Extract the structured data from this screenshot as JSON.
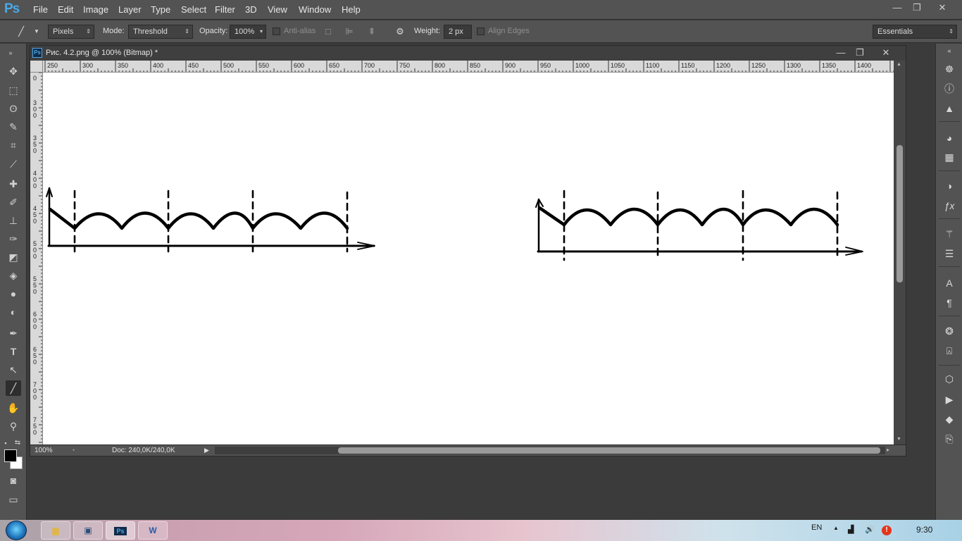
{
  "app": {
    "logo": "Ps"
  },
  "menu": [
    "File",
    "Edit",
    "Image",
    "Layer",
    "Type",
    "Select",
    "Filter",
    "3D",
    "View",
    "Window",
    "Help"
  ],
  "window_controls": {
    "minimize": "—",
    "restore": "❐",
    "close": "✕"
  },
  "options": {
    "tool_mode_value": "Pixels",
    "mode_label": "Mode:",
    "mode_value": "Threshold",
    "opacity_label": "Opacity:",
    "opacity_value": "100%",
    "antialias_label": "Anti-alias",
    "weight_label": "Weight:",
    "weight_value": "2 px",
    "align_edges_label": "Align Edges",
    "workspace_value": "Essentials"
  },
  "document": {
    "title": "Рис. 4.2.png @ 100% (Bitmap) *",
    "ps_badge": "Ps",
    "ruler_top_labels": [
      "250",
      "300",
      "350",
      "400",
      "450",
      "500",
      "550",
      "600",
      "650",
      "700",
      "750",
      "800",
      "850",
      "900",
      "950",
      "1000",
      "1050",
      "1100",
      "1150",
      "1200",
      "1250",
      "1300",
      "1350",
      "1400"
    ],
    "ruler_left_labels": [
      "0",
      "300",
      "350",
      "400",
      "450",
      "500",
      "550",
      "600",
      "650",
      "700",
      "750"
    ],
    "zoom": "100%",
    "doc_size": "Doc: 240,0K/240,0K"
  },
  "taskbar": {
    "lang": "EN",
    "time": "9:30"
  },
  "colors": {
    "accent": "#4aa8e8",
    "ui_bg": "#535353",
    "canvas": "#ffffff"
  }
}
